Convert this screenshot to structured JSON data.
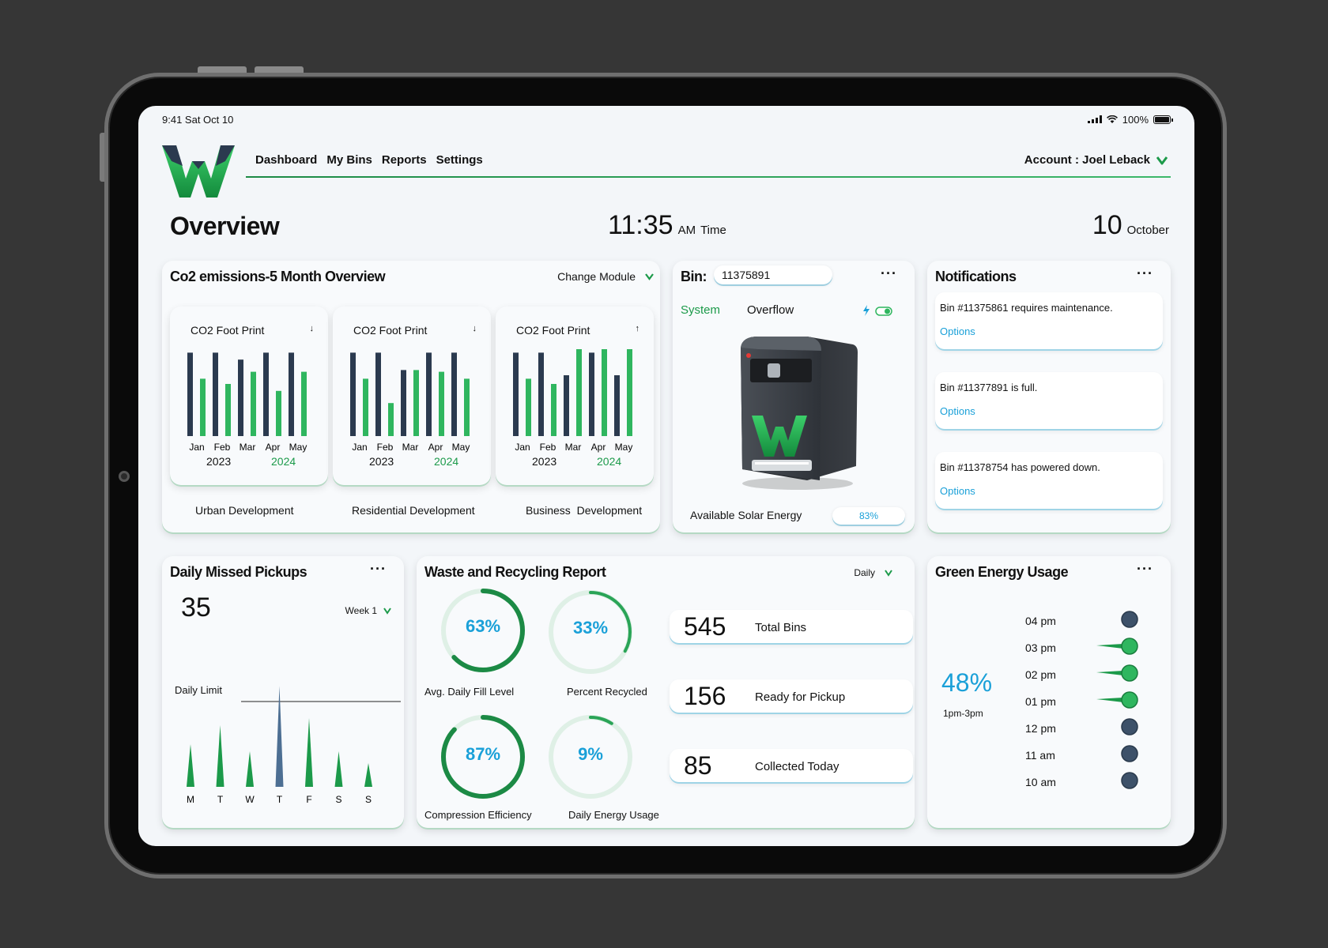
{
  "status_bar": {
    "time_date": "9:41  Sat Oct 10",
    "battery": "100%"
  },
  "nav": {
    "items": [
      "Dashboard",
      "My Bins",
      "Reports",
      "Settings"
    ],
    "account": "Account : Joel Leback"
  },
  "header": {
    "title": "Overview",
    "time": "11:35",
    "ampm": "AM",
    "time_label": "Time",
    "day": "10",
    "month": "October"
  },
  "co2": {
    "title": "Co2 emissions-5 Month Overview",
    "change_module": "Change Module",
    "panels": [
      {
        "title": "CO2 Foot Print",
        "trend": "down",
        "arrow": "↓",
        "label_a": "Urban",
        "label_b": "Development",
        "years": [
          "2023",
          "2024"
        ],
        "months": [
          "Jan",
          "Feb",
          "Mar",
          "Apr",
          "May"
        ],
        "series_2023": [
          48,
          48,
          44,
          48,
          48
        ],
        "series_2024": [
          33,
          30,
          37,
          26,
          37
        ]
      },
      {
        "title": "CO2 Foot Print",
        "trend": "down",
        "arrow": "↓",
        "label_a": "Residential",
        "label_b": "Development",
        "years": [
          "2023",
          "2024"
        ],
        "months": [
          "Jan",
          "Feb",
          "Mar",
          "Apr",
          "May"
        ],
        "series_2023": [
          48,
          48,
          38,
          48,
          48
        ],
        "series_2024": [
          33,
          19,
          38,
          37,
          33
        ]
      },
      {
        "title": "CO2 Foot Print",
        "trend": "up",
        "arrow": "↑",
        "label_a": "Business",
        "label_b": "Development",
        "years": [
          "2023",
          "2024"
        ],
        "months": [
          "Jan",
          "Feb",
          "Mar",
          "Apr",
          "May"
        ],
        "series_2023": [
          48,
          48,
          35,
          48,
          35
        ],
        "series_2024": [
          33,
          30,
          50,
          50,
          50
        ]
      }
    ]
  },
  "bin": {
    "label": "Bin:",
    "id": "11375891",
    "tab_system": "System",
    "tab_overflow": "Overflow",
    "solar_label": "Available  Solar Energy",
    "solar_value": "83%",
    "solar_level": 0.83,
    "toggle_on": true
  },
  "notifications": {
    "title": "Notifications",
    "items": [
      {
        "text": "Bin #11375861 requires maintenance.",
        "option": "Options"
      },
      {
        "text": "Bin #11377891 is full.",
        "option": "Options"
      },
      {
        "text": "Bin #11378754 has powered down.",
        "option": "Options"
      }
    ]
  },
  "missed": {
    "title": "Daily Missed Pickups",
    "count": "35",
    "week": "Week 1",
    "limit_label": "Daily Limit",
    "days": [
      "M",
      "T",
      "W",
      "T",
      "F",
      "S",
      "S"
    ],
    "values": [
      0.36,
      0.52,
      0.3,
      0.85,
      0.58,
      0.3,
      0.2
    ],
    "limit_level": 0.72,
    "highlight_index": 3
  },
  "report": {
    "title": "Waste and Recycling Report",
    "period": "Daily",
    "rings": [
      {
        "value": "63%",
        "fraction": 0.63,
        "label": "Avg.  Daily Fill Level",
        "style": "dark"
      },
      {
        "value": "33%",
        "fraction": 0.33,
        "label": "Percent Recycled",
        "style": "light"
      },
      {
        "value": "87%",
        "fraction": 0.87,
        "label": "Compression Efficiency",
        "style": "dark"
      },
      {
        "value": "9%",
        "fraction": 0.09,
        "label": "Daily Energy Usage",
        "style": "light"
      }
    ],
    "stats": [
      {
        "number": "545",
        "label": "Total Bins"
      },
      {
        "number": "156",
        "label": "Ready for Pickup"
      },
      {
        "number": "85",
        "label": "Collected Today"
      }
    ]
  },
  "energy": {
    "title": "Green Energy Usage",
    "percent": "48%",
    "range": "1pm-3pm",
    "times": [
      "04 pm",
      "03 pm",
      "02 pm",
      "01 pm",
      "12 pm",
      "11 am",
      "10 am"
    ],
    "active": [
      false,
      true,
      true,
      true,
      false,
      false,
      false
    ]
  },
  "colors": {
    "green": "#1c9a4a",
    "navy": "#2b3a4f",
    "blue": "#1aa0d8",
    "bright_green": "#2fb65f"
  }
}
